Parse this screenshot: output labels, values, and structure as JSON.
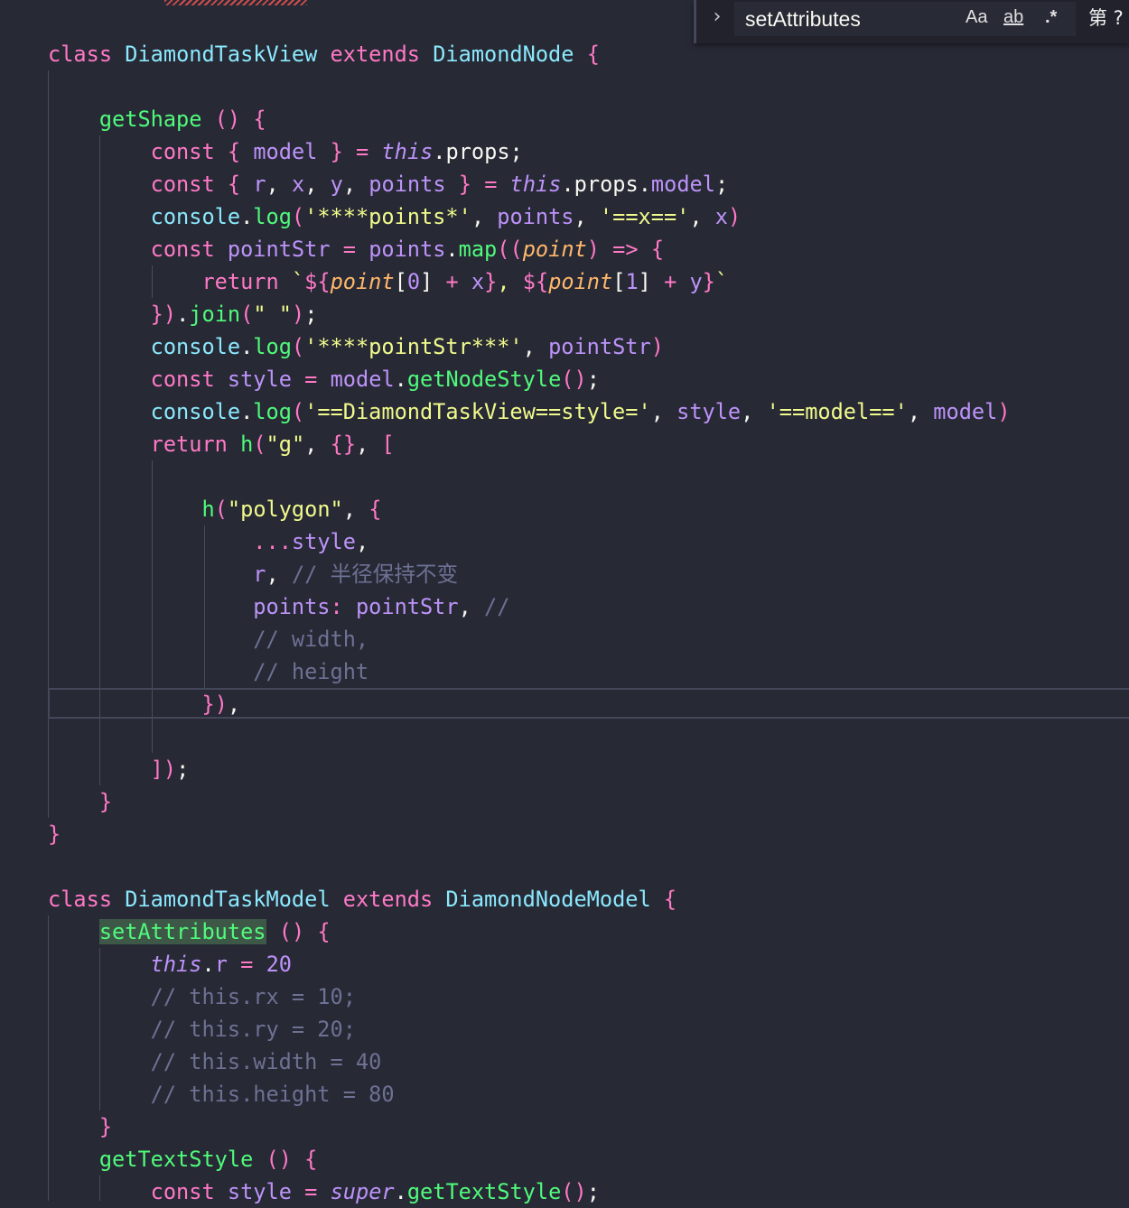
{
  "find_widget": {
    "query": "setAttributes",
    "options": [
      "Aa",
      "ab",
      ".*"
    ],
    "result_text": "第 ?"
  },
  "code_lines": [
    "class DiamondTaskView extends DiamondNode {",
    "",
    "    getShape () {",
    "        const { model } = this.props;",
    "        const { r, x, y, points } = this.props.model;",
    "        console.log('****points*', points, '==x==', x)",
    "        const pointStr = points.map((point) => {",
    "            return `${point[0] + x}, ${point[1] + y}`",
    "        }).join(\" \");",
    "        console.log('****pointStr***', pointStr)",
    "        const style = model.getNodeStyle();",
    "        console.log('==DiamondTaskView==style=', style, '==model==', model)",
    "        return h(\"g\", {}, [",
    "",
    "            h(\"polygon\", {",
    "                ...style,",
    "                r, // 半径保持不变",
    "                points: pointStr, //",
    "                // width,",
    "                // height",
    "            }),",
    "",
    "        ]);",
    "    }",
    "}",
    "",
    "class DiamondTaskModel extends DiamondNodeModel {",
    "    setAttributes () {",
    "        this.r = 20",
    "        // this.rx = 10;",
    "        // this.ry = 20;",
    "        // this.width = 40",
    "        // this.height = 80",
    "    }",
    "    getTextStyle () {",
    "        const style = super.getTextStyle();"
  ],
  "colors": {
    "background": "#272935",
    "keyword": "#ff79c6",
    "class_name": "#8be9fd",
    "function": "#50fa7b",
    "string": "#f1fa8c",
    "variable": "#bd93f9",
    "parameter": "#ffb86c",
    "comment": "#6d7193"
  }
}
